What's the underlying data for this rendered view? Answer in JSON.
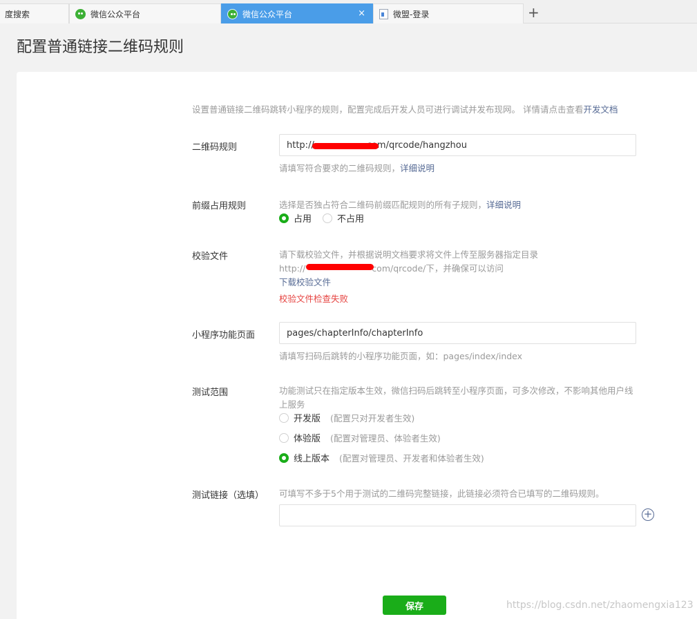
{
  "tabs": [
    {
      "label": "度搜索",
      "icon": "none"
    },
    {
      "label": "微信公众平台",
      "icon": "wechat-icon"
    },
    {
      "label": "微信公众平台",
      "icon": "wechat-icon",
      "active": true,
      "close": "×"
    },
    {
      "label": "微盟-登录",
      "icon": "document-icon"
    }
  ],
  "new_tab": "+",
  "page_title": "配置普通链接二维码规则",
  "intro": {
    "text": "设置普通链接二维码跳转小程序的规则，配置完成后开发人员可进行调试并发布现网。 详情请点击查看",
    "link": "开发文档"
  },
  "qr_rule": {
    "label": "二维码规则",
    "value_prefix": "http://",
    "value_suffix": "com/qrcode/hangzhou",
    "hint": "请填写符合要求的二维码规则，",
    "hint_link": "详细说明"
  },
  "prefix_rule": {
    "label": "前缀占用规则",
    "hint": "选择是否独占符合二维码前缀匹配规则的所有子规则，",
    "hint_link": "详细说明",
    "options": [
      {
        "label": "占用",
        "checked": true
      },
      {
        "label": "不占用",
        "checked": false
      }
    ]
  },
  "verify_file": {
    "label": "校验文件",
    "hint_line1": "请下载校验文件，并根据说明文档要求将文件上传至服务器指定目录",
    "hint_line2_prefix": "http://",
    "hint_line2_suffix": "com/qrcode/下，并确保可以访问",
    "download_link": "下载校验文件",
    "error": "校验文件检查失败"
  },
  "page_path": {
    "label": "小程序功能页面",
    "value": "pages/chapterInfo/chapterInfo",
    "hint": "请填写扫码后跳转的小程序功能页面，如：pages/index/index"
  },
  "test_scope": {
    "label": "测试范围",
    "hint_line1": "功能测试只在指定版本生效，微信扫码后跳转至小程序页面，可多次修改，不影响其他用户线",
    "hint_line2": "上服务",
    "options": [
      {
        "label": "开发版",
        "note": "(配置只对开发者生效)",
        "checked": false
      },
      {
        "label": "体验版",
        "note": "(配置对管理员、体验者生效)",
        "checked": false
      },
      {
        "label": "线上版本",
        "note": "(配置对管理员、开发者和体验者生效)",
        "checked": true
      }
    ]
  },
  "test_links": {
    "label": "测试链接（选填）",
    "hint": "可填写不多于5个用于测试的二维码完整链接，此链接必须符合已填写的二维码规则。",
    "value": "",
    "add_button": "+"
  },
  "save_button": "保存",
  "watermark": "https://blog.csdn.net/zhaomengxia123",
  "colors": {
    "accent_green": "#1aad19",
    "link_blue": "#576b95",
    "error_red": "#e64340",
    "active_tab": "#4a9de8"
  }
}
